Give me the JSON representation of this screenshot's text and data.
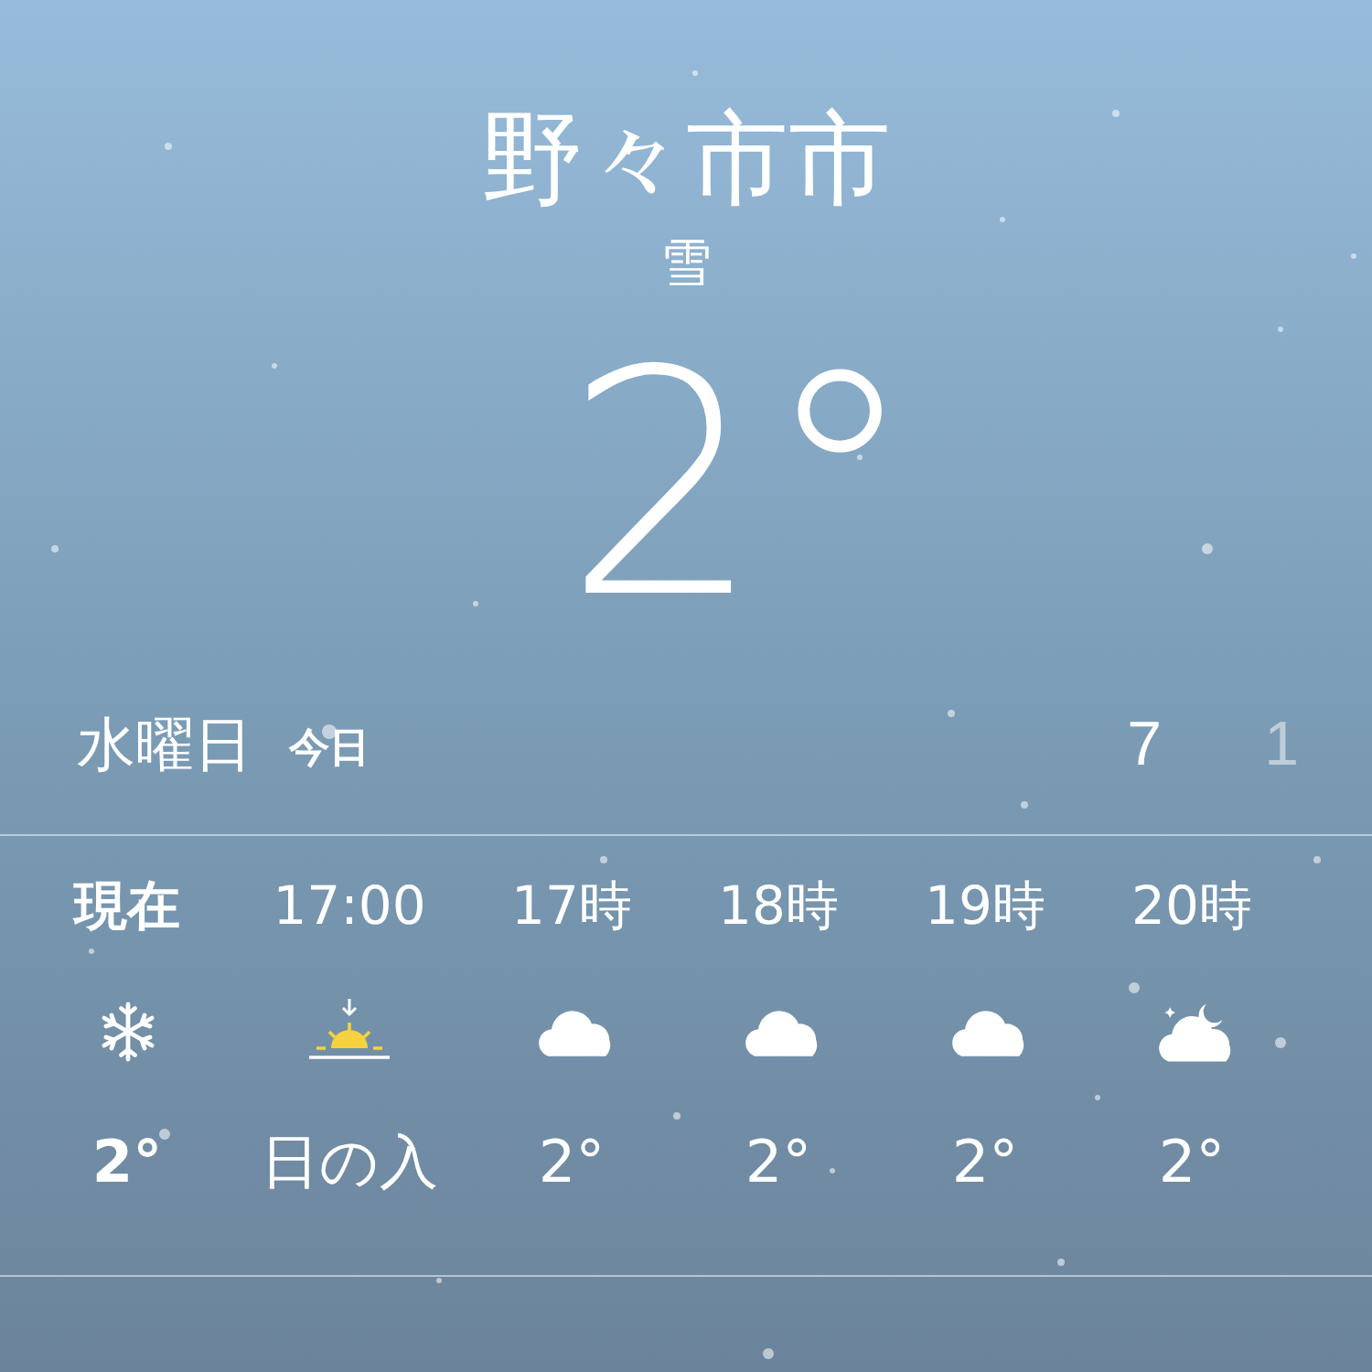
{
  "location": {
    "city": "野々市市",
    "condition": "雪",
    "temperature": "2°"
  },
  "today": {
    "day": "水曜日",
    "label": "今日",
    "high": "7",
    "low": "1"
  },
  "hourly": [
    {
      "current": true,
      "time": "現在",
      "kind": "snow",
      "value": "2°"
    },
    {
      "current": false,
      "time": "17:00",
      "kind": "sunset",
      "value": "日の入"
    },
    {
      "current": false,
      "time": "17時",
      "kind": "cloud",
      "value": "2°"
    },
    {
      "current": false,
      "time": "18時",
      "kind": "cloud",
      "value": "2°"
    },
    {
      "current": false,
      "time": "19時",
      "kind": "cloud",
      "value": "2°"
    },
    {
      "current": false,
      "time": "20時",
      "kind": "cloudmoon",
      "value": "2°"
    }
  ]
}
